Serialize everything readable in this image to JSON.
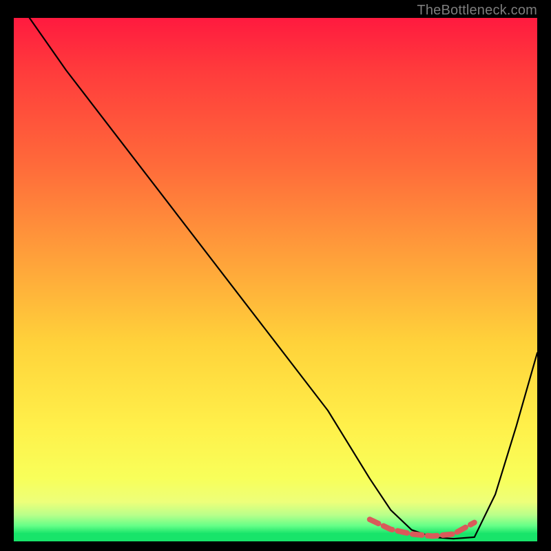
{
  "watermark": "TheBottleneck.com",
  "chart_data": {
    "type": "line",
    "title": "",
    "xlabel": "",
    "ylabel": "",
    "xlim": [
      0,
      100
    ],
    "ylim": [
      0,
      100
    ],
    "grid": false,
    "legend": false,
    "series": [
      {
        "name": "bottleneck-curve",
        "color": "#000000",
        "x": [
          3,
          10,
          20,
          30,
          40,
          50,
          60,
          68,
          72,
          76,
          80,
          84,
          88,
          92,
          96,
          100
        ],
        "y": [
          100,
          90,
          77,
          64,
          51,
          38,
          25,
          12,
          6,
          2.2,
          0.8,
          0.5,
          0.8,
          9,
          22,
          36
        ]
      },
      {
        "name": "highlight-band",
        "color": "#d95a5a",
        "x": [
          68,
          72,
          76,
          80,
          84,
          88
        ],
        "y": [
          4.2,
          2.3,
          1.4,
          1.0,
          1.4,
          3.6
        ]
      }
    ],
    "annotations": []
  }
}
